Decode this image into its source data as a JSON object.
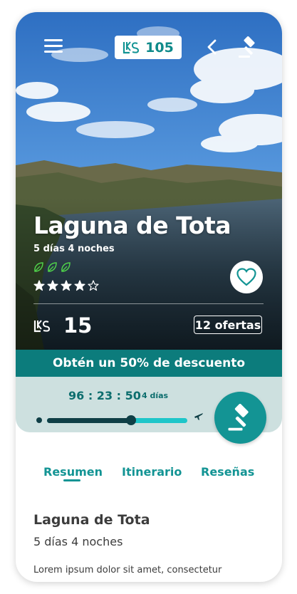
{
  "header": {
    "coins": "105"
  },
  "destination": {
    "title": "Laguna de Tota",
    "duration": "5 días 4 noches",
    "eco_leaves": 3,
    "rating": 4,
    "rating_max": 5,
    "price": "15",
    "offers_label": "12 ofertas"
  },
  "discount": {
    "label": "Obtén un 50% de descuento"
  },
  "timer": {
    "countdown": "96 : 23 : 50",
    "days_label": "4 días",
    "progress": 0.6
  },
  "tabs": [
    {
      "label": "Resumen",
      "active": true
    },
    {
      "label": "Itinerario",
      "active": false
    },
    {
      "label": "Reseñas",
      "active": false
    }
  ],
  "summary": {
    "title": "Laguna de Tota",
    "subtitle": "5 días 4 noches",
    "body": "Lorem ipsum dolor sit amet, consectetur"
  },
  "colors": {
    "accent": "#139494",
    "banner": "#0c7c7c",
    "timer_bg": "#cde0df"
  },
  "icons": [
    "menu-icon",
    "coin-icon",
    "back-icon",
    "gavel-icon",
    "leaf-icon",
    "star-icon",
    "heart-icon",
    "plane-icon"
  ]
}
